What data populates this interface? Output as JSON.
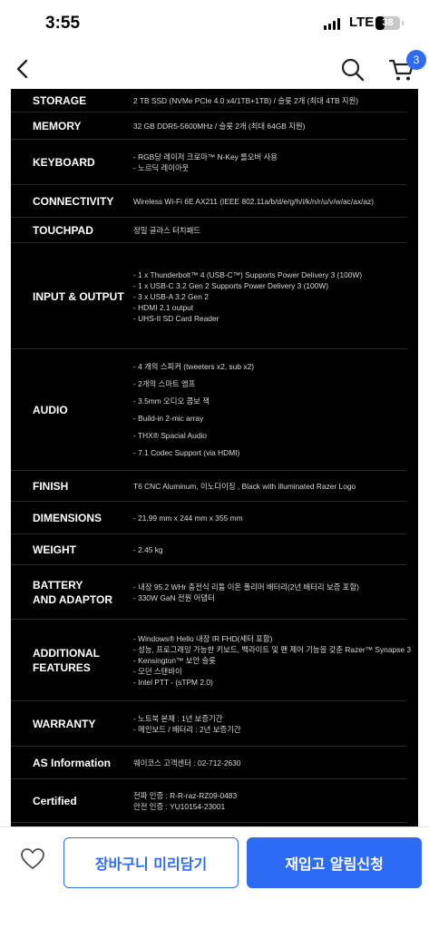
{
  "status_bar": {
    "time": "3:55",
    "network": "LTE",
    "battery": "38",
    "battery_level": 0.38
  },
  "nav": {
    "cart_count": "3",
    "icons": [
      "chevron-left-icon",
      "search-icon",
      "cart-icon"
    ]
  },
  "specs": [
    {
      "label": "STORAGE",
      "values": [
        "2 TB SSD (NVMe PCIe 4.0 x4/1TB+1TB) / 슬롯 2개 (최대 4TB 지원)"
      ]
    },
    {
      "label": "MEMORY",
      "values": [
        "32 GB DDR5-5600MHz / 슬롯 2개 (최대 64GB 지원)"
      ]
    },
    {
      "label": "KEYBOARD",
      "values": [
        "- RGB당 레이저 크로마™ N-Key 롤오버 사용",
        "- 노르딕 레이아웃"
      ]
    },
    {
      "label": "CONNECTIVITY",
      "values": [
        "Wireless Wi-Fi 6E AX211 (IEEE 802.11a/b/d/e/g/h/i/k/n/r/u/v/w/ac/ax/az)"
      ]
    },
    {
      "label": "TOUCHPAD",
      "values": [
        "정밀 글라스 터치패드"
      ]
    },
    {
      "label": "INPUT & OUTPUT",
      "values": [
        "- 1 x Thunderbolt™ 4 (USB-C™) Supports Power Delivery 3 (100W)",
        "- 1 x USB-C 3.2 Gen 2  Supports Power Delivery 3 (100W)",
        "- 3 x USB-A 3.2 Gen 2",
        "- HDMI 2.1 output",
        "- UHS-II SD Card Reader"
      ]
    },
    {
      "label": "AUDIO",
      "values": [
        "- 4 개의 스피커 (tweeters x2, sub x2)",
        "- 2개의 스마트 앰프",
        "- 3.5mm 오디오 콤보 잭",
        "- Build-in 2-mic array",
        "- THX® Spacial Audio",
        "- 7.1 Codec Support (via HDMI)"
      ]
    },
    {
      "label": "FINISH",
      "values": [
        "T6 CNC Aluminum, 이노다이징 , Black with illuminated Razer Logo"
      ]
    },
    {
      "label": "DIMENSIONS",
      "values": [
        "- 21.99 mm x 244 mm x 355 mm"
      ]
    },
    {
      "label": "WEIGHT",
      "values": [
        "- 2.45 kg"
      ]
    },
    {
      "label": "BATTERY\nAND ADAPTOR",
      "values": [
        "- 내장 95.2 WHr 충전식 리튬 이온 폴리머 배터리(2년 배터리 보증 포함)",
        "- 330W GaN 전원 어댑터"
      ]
    },
    {
      "label": "ADDITIONAL\nFEATURES",
      "values": [
        "- Windows® Hello 내장 IR FHD(세터 포함)",
        "- 성능, 프로그래밍 가능한 키보드, 백라이트 및 팬 제어 기능을 갖춘 Razer™ Synapse 3",
        "- Kensington™ 보안 슬롯",
        "- 모던 스탠바이",
        "- Intel PTT - (sTPM 2.0)"
      ]
    },
    {
      "label": "WARRANTY",
      "values": [
        "- 노트북 본체 : 1년 보증기간",
        "- 메인보드 / 배터리 : 2년 보증기간"
      ]
    },
    {
      "label": "AS Information",
      "values": [
        "웨이코스 고객센터 :  02-712-2630"
      ]
    },
    {
      "label": "Certified",
      "values": [
        "전파 인증 : R-R-raz-RZ09-0483",
        "안전 인증 : YU10154-23001"
      ]
    }
  ],
  "bottom_bar": {
    "cart_button": "장바구니 미리담기",
    "notify_button": "재입고 알림신청"
  },
  "colors": {
    "accent": "#2d6bf5",
    "spec_background": "#000000"
  }
}
